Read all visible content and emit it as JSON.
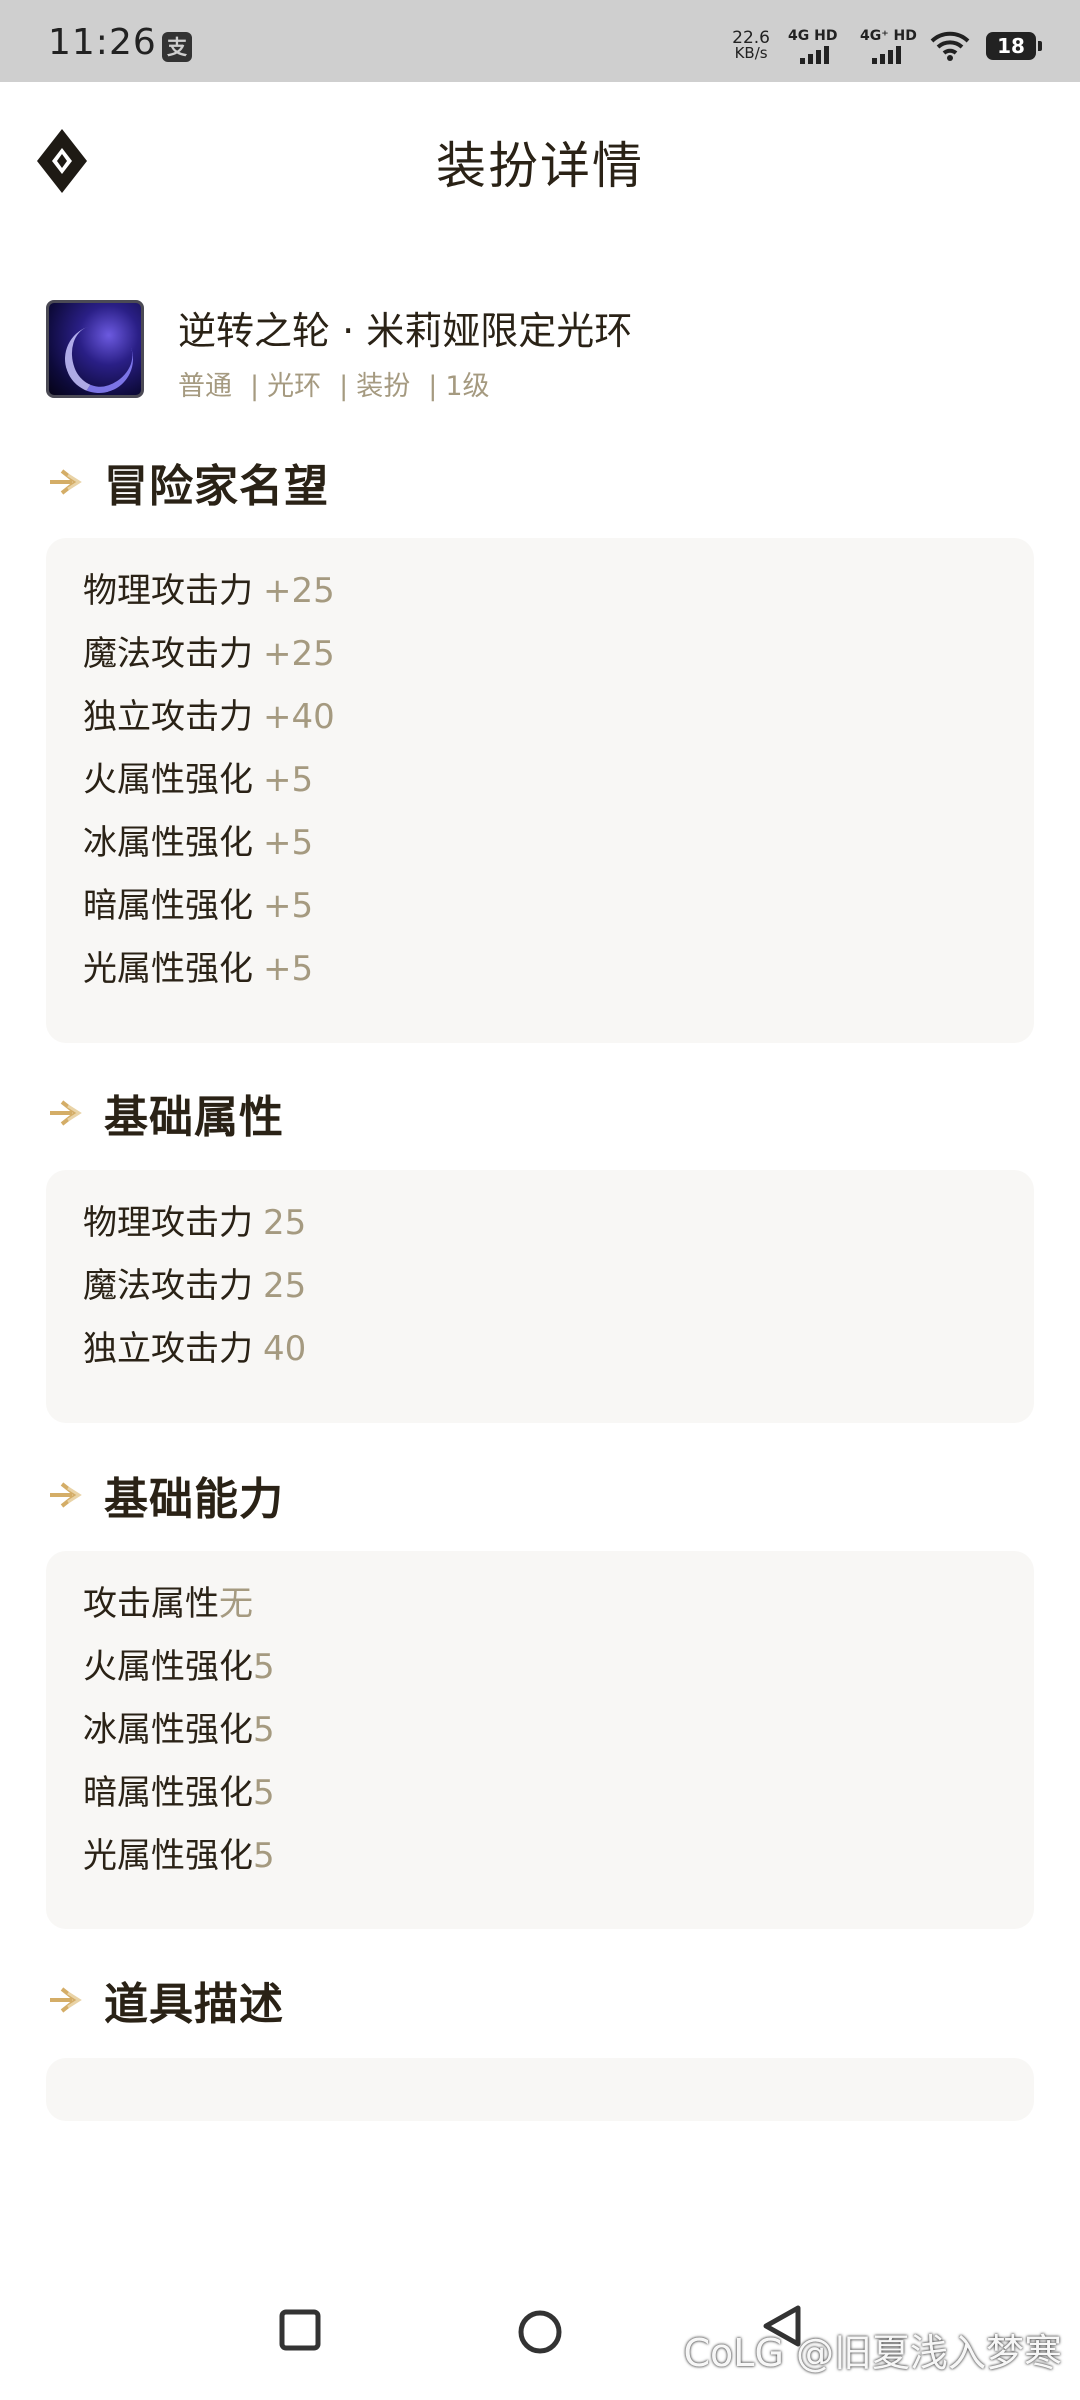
{
  "status_bar": {
    "time": "11:26",
    "app_icon_char": "支",
    "net_speed_value": "22.6",
    "net_speed_unit": "KB/s",
    "sim1_label": "4G HD",
    "sim2_label": "4G⁺ HD",
    "battery_level": "18"
  },
  "header": {
    "title": "装扮详情",
    "logo_icon": "diamond-logo-icon"
  },
  "item": {
    "name": "逆转之轮 · 米莉娅限定光环",
    "tags": [
      "普通",
      "光环",
      "装扮",
      "1级"
    ]
  },
  "sections": [
    {
      "title": "冒险家名望",
      "rows": [
        {
          "name": "物理攻击力",
          "value": "+25"
        },
        {
          "name": "魔法攻击力",
          "value": "+25"
        },
        {
          "name": "独立攻击力",
          "value": "+40"
        },
        {
          "name": "火属性强化",
          "value": "+5"
        },
        {
          "name": "冰属性强化",
          "value": "+5"
        },
        {
          "name": "暗属性强化",
          "value": "+5"
        },
        {
          "name": "光属性强化",
          "value": "+5"
        }
      ]
    },
    {
      "title": "基础属性",
      "rows": [
        {
          "name": "物理攻击力",
          "value": "25"
        },
        {
          "name": "魔法攻击力",
          "value": "25"
        },
        {
          "name": "独立攻击力",
          "value": "40"
        }
      ]
    },
    {
      "title": "基础能力",
      "rows": [
        {
          "name": "攻击属性",
          "value": "无"
        },
        {
          "name": "火属性强化",
          "value": "5"
        },
        {
          "name": "冰属性强化",
          "value": "5"
        },
        {
          "name": "暗属性强化",
          "value": "5"
        },
        {
          "name": "光属性强化",
          "value": "5"
        }
      ]
    },
    {
      "title": "道具描述",
      "rows": []
    }
  ],
  "watermark": "CoLG @旧夏浅入梦寒",
  "colors": {
    "accent_arrow": "#d4ad67",
    "value_text": "#a59a80",
    "card_bg": "#f8f7f5",
    "title_text": "#2a2216"
  }
}
